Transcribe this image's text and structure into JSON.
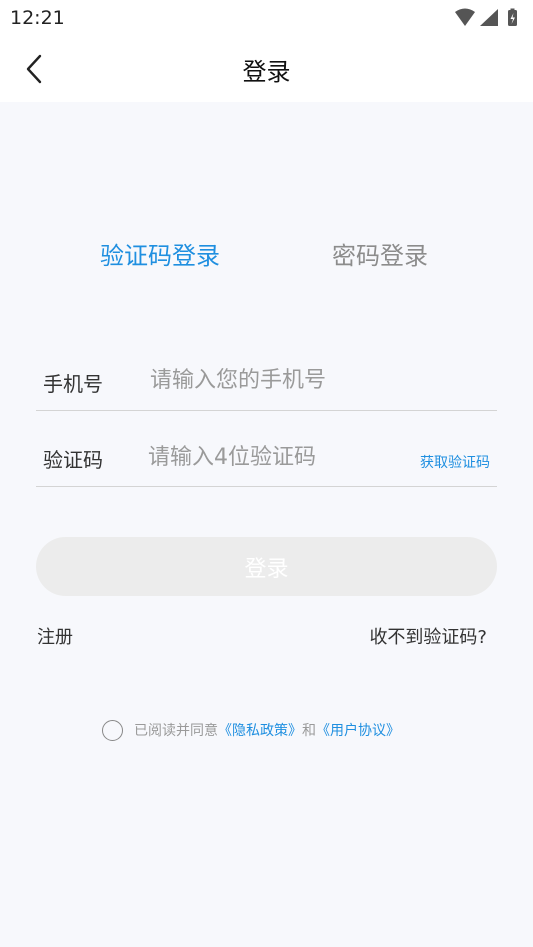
{
  "status_bar": {
    "time": "12:21",
    "icons": [
      "wifi-icon",
      "signal-icon",
      "battery-icon"
    ]
  },
  "header": {
    "title": "登录",
    "back_icon": "chevron-left-icon"
  },
  "tabs": [
    {
      "label": "验证码登录",
      "active": true
    },
    {
      "label": "密码登录",
      "active": false
    }
  ],
  "form": {
    "phone": {
      "label": "手机号",
      "placeholder": "请输入您的手机号",
      "value": ""
    },
    "code": {
      "label": "验证码",
      "placeholder": "请输入4位验证码",
      "value": "",
      "get_code_label": "获取验证码"
    }
  },
  "login_button": {
    "label": "登录",
    "enabled": false
  },
  "links": {
    "register": "注册",
    "no_code": "收不到验证码?"
  },
  "agreement": {
    "checked": false,
    "prefix": "已阅读并同意",
    "privacy_link": "《隐私政策》",
    "conjunction": "和",
    "terms_link": "《用户协议》"
  },
  "colors": {
    "accent": "#1f8fe0",
    "inactive_tab": "#8c8c8c",
    "disabled_button": "#ececec",
    "background": "#f7f8fc"
  }
}
